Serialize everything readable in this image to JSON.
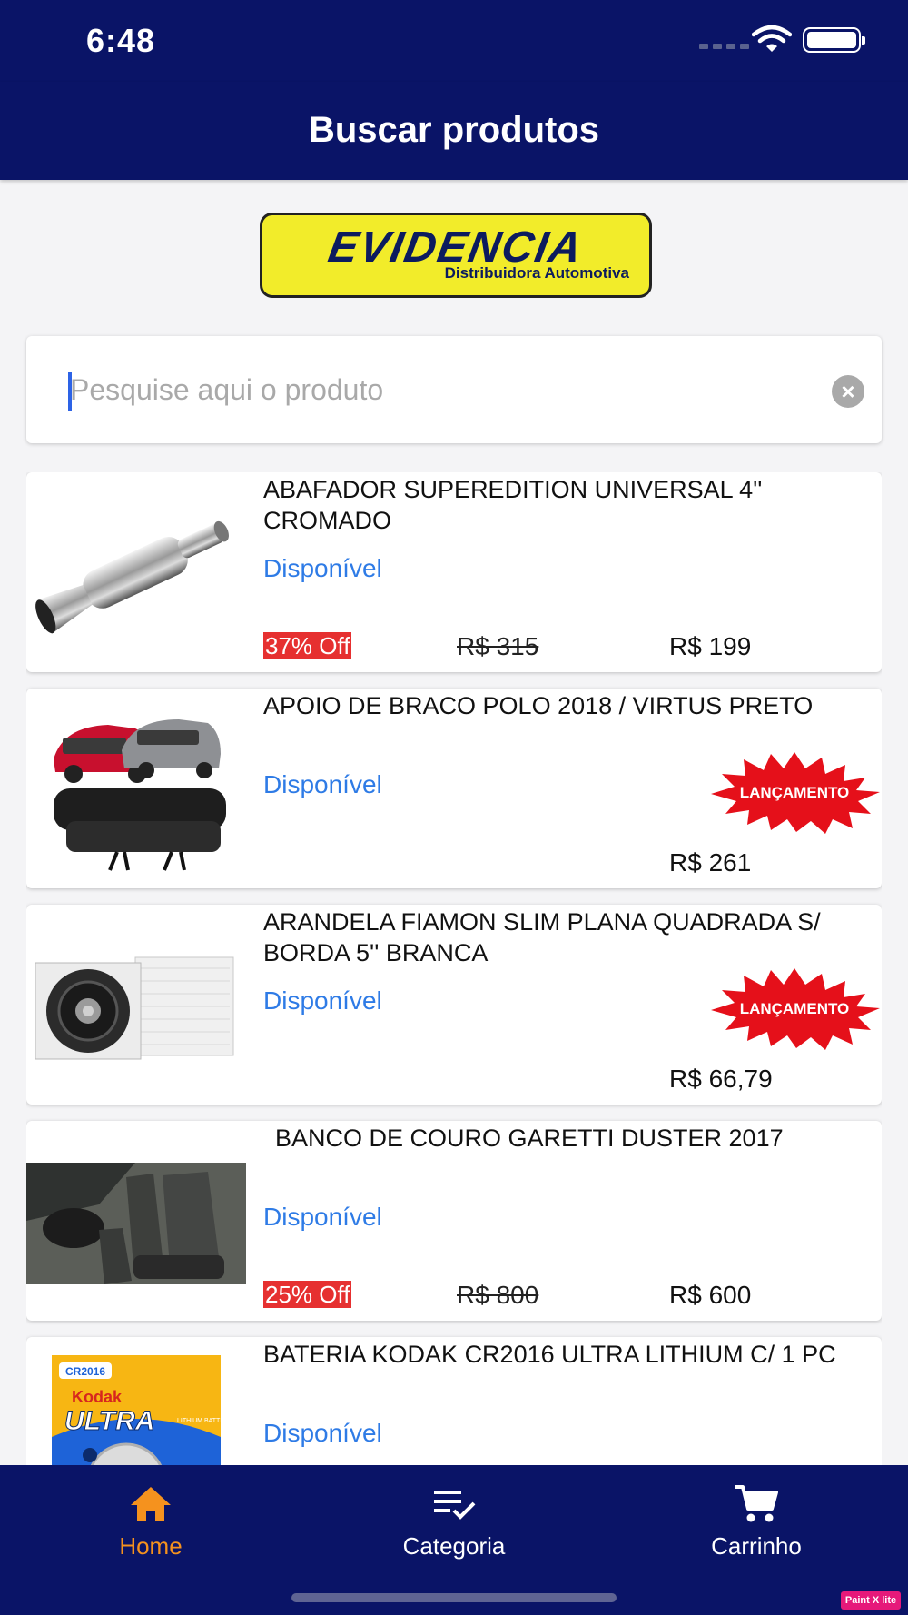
{
  "status_bar": {
    "time": "6:48"
  },
  "header": {
    "title": "Buscar produtos"
  },
  "logo": {
    "name": "EVIDENCIA",
    "subtitle": "Distribuidora Automotiva"
  },
  "search": {
    "placeholder": "Pesquise aqui o produto",
    "value": ""
  },
  "products": [
    {
      "name": "ABAFADOR SUPEREDITION UNIVERSAL 4'' CROMADO",
      "status": "Disponível",
      "discount": "37% Off",
      "old_price": "R$  315",
      "price": "R$  199",
      "release_badge": ""
    },
    {
      "name": "APOIO DE BRACO POLO 2018 / VIRTUS PRETO",
      "status": "Disponível",
      "discount": "",
      "old_price": "",
      "price": "R$  261",
      "release_badge": "LANÇAMENTO"
    },
    {
      "name": "ARANDELA FIAMON SLIM PLANA QUADRADA S/ BORDA 5'' BRANCA",
      "status": "Disponível",
      "discount": "",
      "old_price": "",
      "price": "R$  66,79",
      "release_badge": "LANÇAMENTO"
    },
    {
      "name": "BANCO DE COURO GARETTI DUSTER 2017",
      "status": "Disponível",
      "discount": "25% Off",
      "old_price": "R$  800",
      "price": "R$  600",
      "release_badge": ""
    },
    {
      "name": "BATERIA KODAK CR2016 ULTRA LITHIUM C/ 1 PC",
      "status": "Disponível",
      "discount": "",
      "old_price": "",
      "price": "",
      "release_badge": ""
    }
  ],
  "product_images": {
    "p1": "muffler",
    "p2": "armrest",
    "p3": "speaker-panel",
    "p4": "car-seats",
    "p5": "battery-pack"
  },
  "battery_image": {
    "brand": "Kodak",
    "model": "ULTRA",
    "code": "CR2016",
    "type": "LITHIUM BATTERY"
  },
  "tabs": [
    {
      "label": "Home",
      "icon": "home-icon",
      "active": true
    },
    {
      "label": "Categoria",
      "icon": "list-check-icon",
      "active": false
    },
    {
      "label": "Carrinho",
      "icon": "cart-icon",
      "active": false
    }
  ],
  "watermark": "Paint X lite",
  "colors": {
    "primary": "#0a1467",
    "accent": "#f5921e",
    "available": "#2e7be6",
    "discount": "#e63030"
  }
}
